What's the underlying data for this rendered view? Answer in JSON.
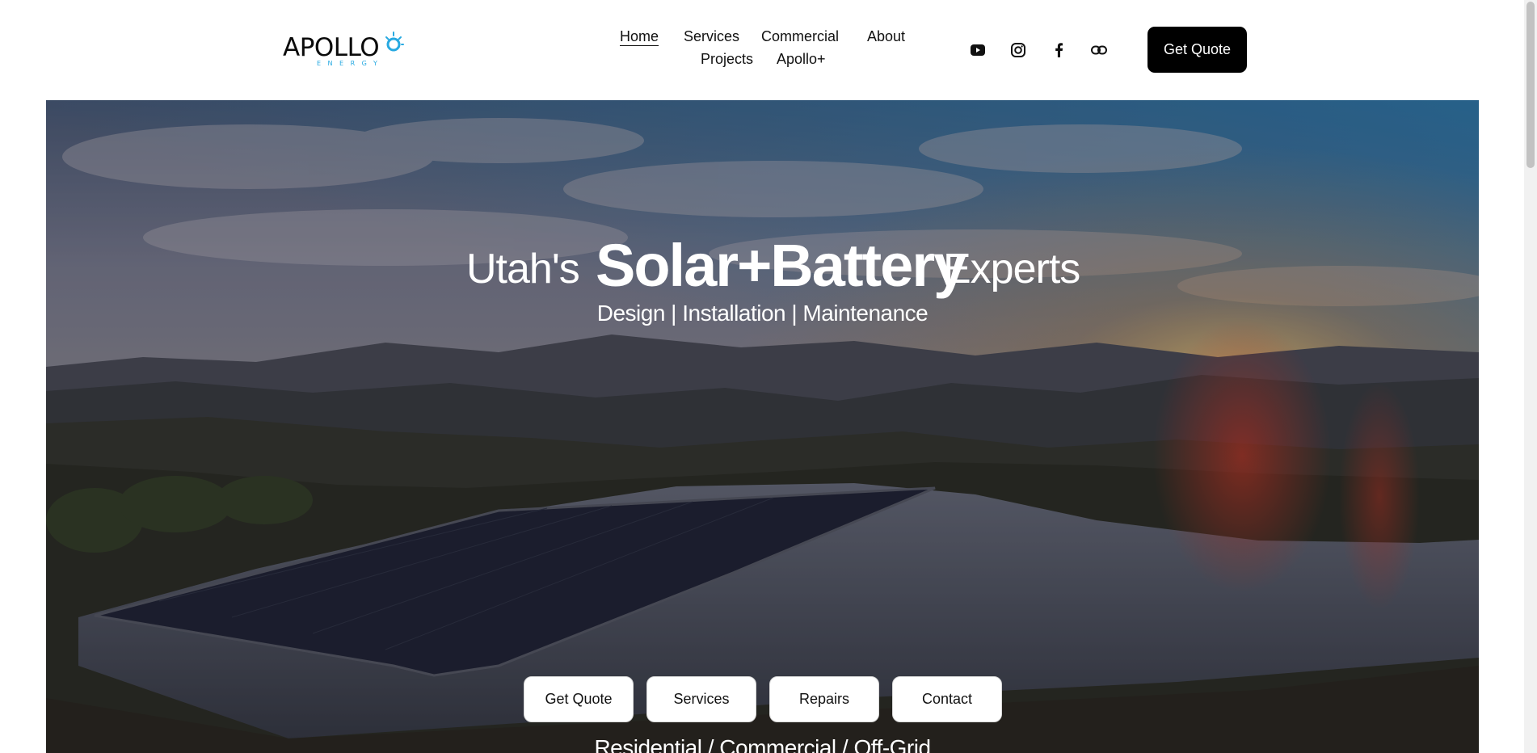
{
  "brand": {
    "logo_text": "APOLLO",
    "logo_sub": "ENERGY",
    "logo_color": "#27a9e1"
  },
  "nav": {
    "items": [
      {
        "label": "Home",
        "active": true
      },
      {
        "label": "Services"
      },
      {
        "label": "Commercial"
      },
      {
        "label": "About"
      },
      {
        "label": "Projects"
      },
      {
        "label": "Apollo+"
      }
    ]
  },
  "social": [
    "youtube-icon",
    "instagram-icon",
    "facebook-icon",
    "link-icon"
  ],
  "header_cta": {
    "label": "Get Quote"
  },
  "hero": {
    "title_left": "Utah's",
    "title_main": "Solar+Battery",
    "title_right": "Experts",
    "subtitle": "Design | Installation | Maintenance",
    "buttons": [
      {
        "label": "Get Quote"
      },
      {
        "label": "Services"
      },
      {
        "label": "Repairs"
      },
      {
        "label": "Contact"
      }
    ],
    "footer_line": "Residential / Commercial / Off-Grid"
  },
  "colors": {
    "header_bg": "#ffffff",
    "cta_bg": "#000000",
    "accent": "#27a9e1"
  }
}
